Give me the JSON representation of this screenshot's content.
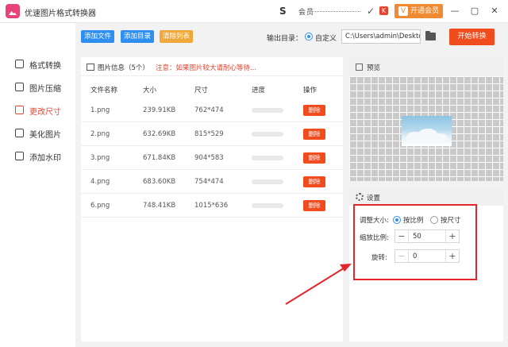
{
  "titlebar": {
    "app_title": "优速图片格式转换器",
    "tray_text": "会员",
    "tray_check": "✓",
    "tray_badge": "K",
    "vip_icon": "V",
    "vip_label": "开通会员",
    "minimize": "—",
    "restore": "▢",
    "close": "✕"
  },
  "sidebar": {
    "items": [
      {
        "label": "格式转换",
        "icon": "format-convert-icon"
      },
      {
        "label": "图片压缩",
        "icon": "compress-icon"
      },
      {
        "label": "更改尺寸",
        "icon": "resize-icon",
        "active": true
      },
      {
        "label": "美化图片",
        "icon": "beautify-icon"
      },
      {
        "label": "添加水印",
        "icon": "watermark-icon"
      }
    ]
  },
  "toolbar": {
    "add_file": "添加文件",
    "add_dir": "添加目录",
    "clear_list": "清除列表",
    "output_label": "输出目录：",
    "custom_label": "自定义",
    "output_path": "C:\\Users\\admin\\Deskto",
    "start": "开始转换"
  },
  "file_panel": {
    "title": "图片信息（5个）",
    "warning": "注意：如果图片较大请耐心等待...",
    "columns": [
      "文件名称",
      "大小",
      "尺寸",
      "进度",
      "操作"
    ],
    "delete_label": "删除",
    "rows": [
      {
        "name": "1.png",
        "size": "239.91KB",
        "dims": "762*474"
      },
      {
        "name": "2.png",
        "size": "632.69KB",
        "dims": "815*529"
      },
      {
        "name": "3.png",
        "size": "671.84KB",
        "dims": "904*583"
      },
      {
        "name": "4.png",
        "size": "683.60KB",
        "dims": "754*474"
      },
      {
        "name": "6.png",
        "size": "748.41KB",
        "dims": "1015*636"
      }
    ]
  },
  "preview": {
    "title": "预览"
  },
  "settings": {
    "title": "设置",
    "resize_label": "调整大小:",
    "by_ratio": "按比例",
    "by_size": "按尺寸",
    "scale_label": "缩放比例:",
    "scale_value": "50",
    "rotate_label": "旋转:",
    "rotate_value": "0",
    "minus": "−",
    "plus": "+"
  },
  "colors": {
    "accent_red": "#e4442f",
    "blue": "#2f8ff0",
    "orange": "#f0a83a",
    "vip": "#f08a32"
  }
}
